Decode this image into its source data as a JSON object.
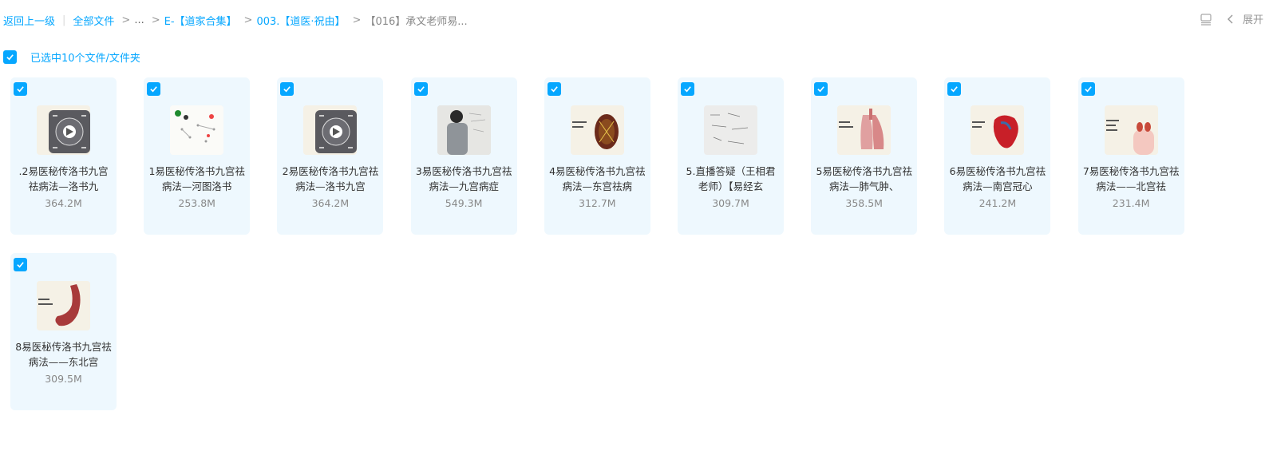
{
  "breadcrumb": {
    "back": "返回上一级",
    "all_files": "全部文件",
    "sep": ">",
    "ellipsis": "...",
    "crumb1": "E-【道家合集】",
    "crumb2": "003.【道医·祝由】",
    "current": "【016】承文老师易..."
  },
  "toolbar": {
    "expand_label": "展开",
    "view_icon": "list-view-icon",
    "chevron_icon": "chevron-left-icon"
  },
  "selection": {
    "label": "已选中10个文件/文件夹",
    "checked": true
  },
  "colors": {
    "accent": "#06a7ff",
    "card_bg": "#eef8fe"
  },
  "files": [
    {
      "name": ".2易医秘传洛书九宫祛病法—洛书九",
      "size": "364.2M",
      "thumb": "bagua-video"
    },
    {
      "name": "1易医秘传洛书九宫祛病法—河图洛书",
      "size": "253.8M",
      "thumb": "diagram-video"
    },
    {
      "name": "2易医秘传洛书九宫祛病法—洛书九宫",
      "size": "364.2M",
      "thumb": "bagua-video"
    },
    {
      "name": "3易医秘传洛书九宫祛病法—九宫病症",
      "size": "549.3M",
      "thumb": "teacher-video"
    },
    {
      "name": "4易医秘传洛书九宫祛病法—东宫祛病",
      "size": "312.7M",
      "thumb": "liver-video"
    },
    {
      "name": "5.直播答疑（王相君老师）【易经玄",
      "size": "309.7M",
      "thumb": "whiteboard-video"
    },
    {
      "name": "5易医秘传洛书九宫祛病法—肺气肿、",
      "size": "358.5M",
      "thumb": "lung-video"
    },
    {
      "name": "6易医秘传洛书九宫祛病法—南宫冠心",
      "size": "241.2M",
      "thumb": "heart-video"
    },
    {
      "name": "7易医秘传洛书九宫祛病法——北宫祛",
      "size": "231.4M",
      "thumb": "kidney-video"
    },
    {
      "name": "8易医秘传洛书九宫祛病法——东北宫",
      "size": "309.5M",
      "thumb": "stomach-video"
    }
  ]
}
